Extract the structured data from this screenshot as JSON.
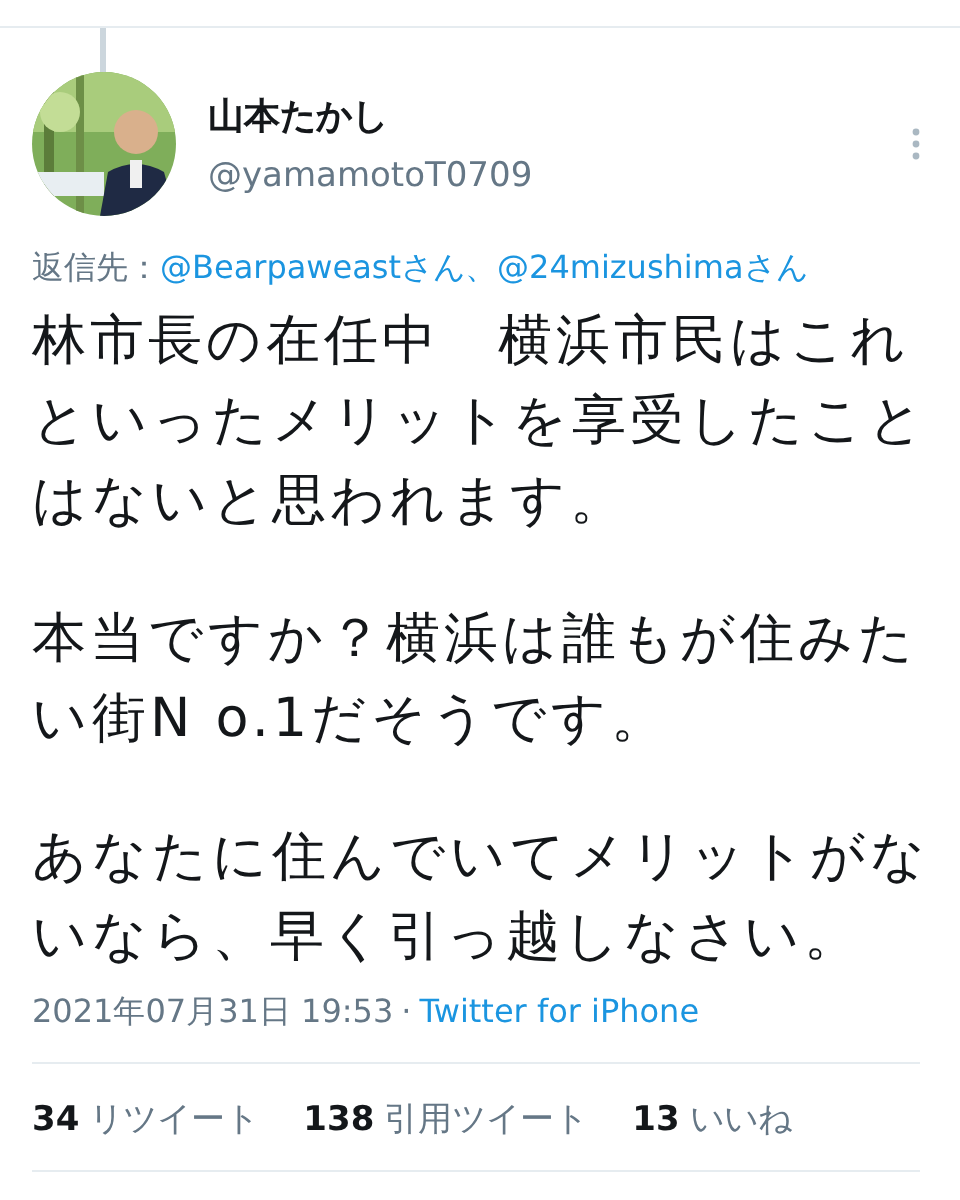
{
  "tweet": {
    "author": {
      "name": "山本たかし",
      "handle": "@yamamotoT0709"
    },
    "reply_to": {
      "label": "返信先：",
      "separator": "、",
      "mentions": [
        "@Bearpaweastさん",
        "@24mizushimaさん"
      ]
    },
    "paragraphs": [
      "林市長の在任中　横浜市民はこれといったメリットを享受したことはないと思われます。",
      "本当ですか？横浜は誰もが住みたい街N o.1だそうです。",
      "あなたに住んでいてメリットがないなら、早く引っ越しなさい。"
    ],
    "timestamp": "2021年07月31日 19:53",
    "meta_separator": "·",
    "source": "Twitter for iPhone",
    "stats": [
      {
        "count": "34",
        "label": "リツイート"
      },
      {
        "count": "138",
        "label": "引用ツイート"
      },
      {
        "count": "13",
        "label": "いいね"
      }
    ]
  }
}
